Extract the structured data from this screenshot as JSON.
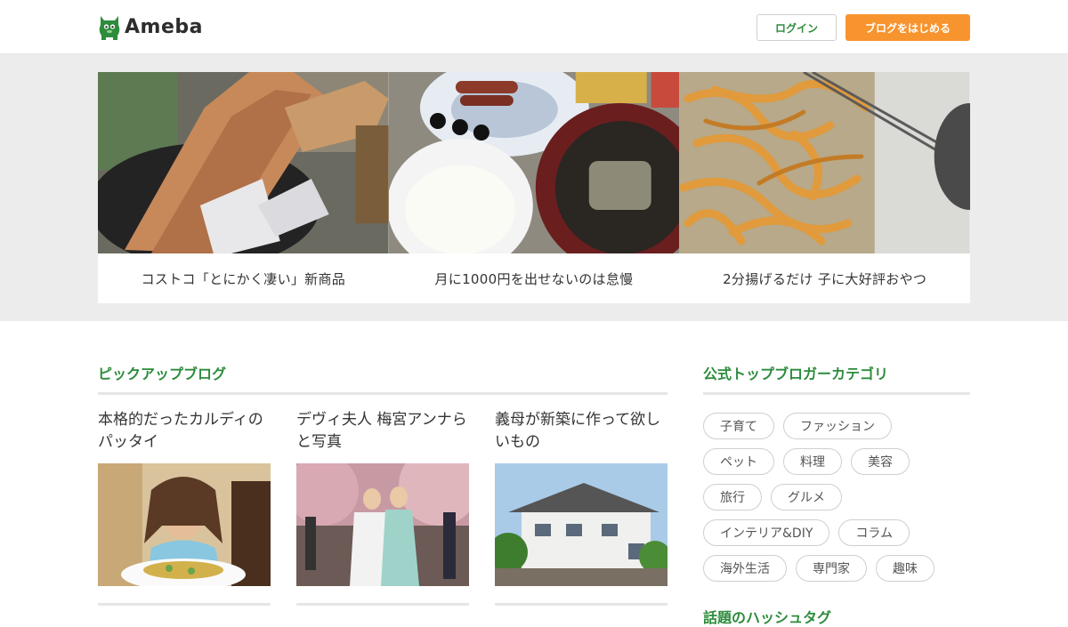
{
  "header": {
    "logo_text": "Ameba",
    "login_label": "ログイン",
    "start_label": "ブログをはじめる"
  },
  "hero": {
    "cards": [
      {
        "caption": "コストコ「とにかく凄い」新商品"
      },
      {
        "caption": "月に1000円を出せないのは怠慢"
      },
      {
        "caption": "2分揚げるだけ 子に大好評おやつ"
      }
    ]
  },
  "pickup": {
    "title": "ピックアップブログ",
    "items": [
      {
        "title": "本格的だったカルディのパッタイ"
      },
      {
        "title": "デヴィ夫人 梅宮アンナらと写真"
      },
      {
        "title": "義母が新築に作って欲しいもの"
      }
    ]
  },
  "categories": {
    "title": "公式トップブロガーカテゴリ",
    "rows": [
      [
        "子育て",
        "ファッション"
      ],
      [
        "ペット",
        "料理",
        "美容"
      ],
      [
        "旅行",
        "グルメ"
      ],
      [
        "インテリア&DIY",
        "コラム"
      ],
      [
        "海外生活",
        "専門家",
        "趣味"
      ]
    ]
  },
  "hashtags": {
    "title": "話題のハッシュタグ"
  },
  "colors": {
    "brand_green": "#2d8c3c",
    "accent_orange": "#f7942e"
  }
}
